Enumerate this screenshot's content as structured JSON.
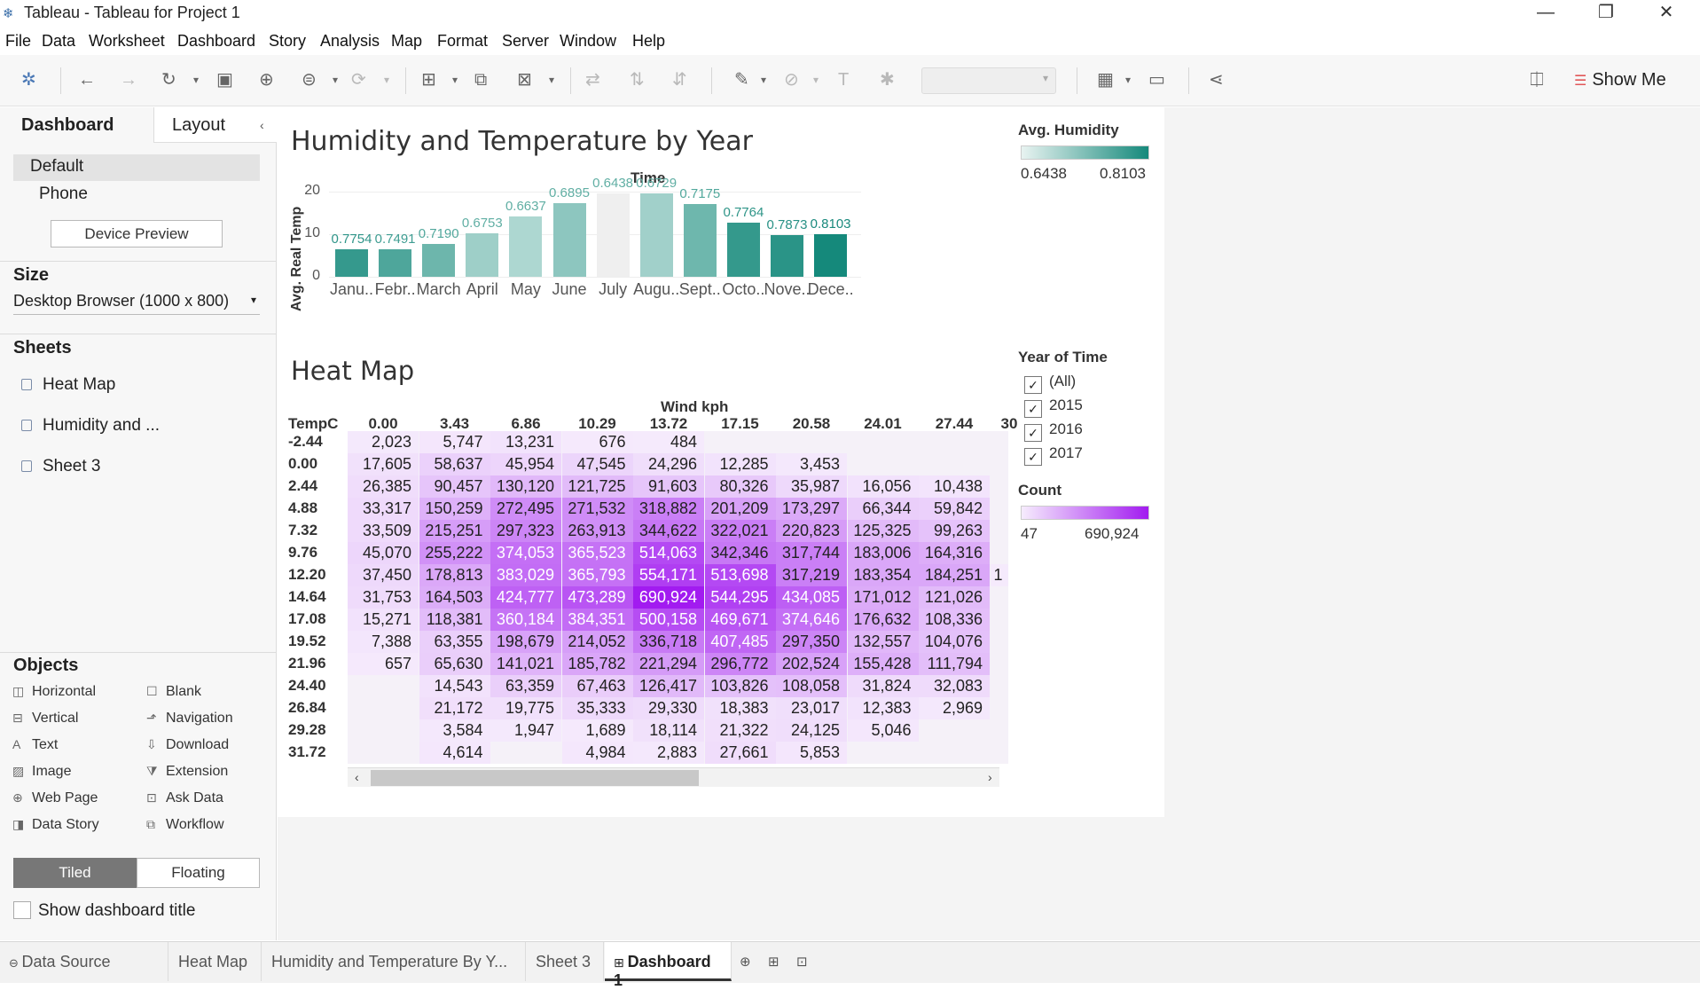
{
  "window": {
    "title": "Tableau - Tableau for Project 1",
    "minimize": "—",
    "restore": "❐",
    "close": "✕"
  },
  "menu": [
    "File",
    "Data",
    "Worksheet",
    "Dashboard",
    "Story",
    "Analysis",
    "Map",
    "Format",
    "Server",
    "Window",
    "Help"
  ],
  "toolbar": {
    "show_me": "Show Me"
  },
  "left_panel": {
    "tabs": {
      "dashboard": "Dashboard",
      "layout": "Layout"
    },
    "devices": [
      "Default",
      "Phone"
    ],
    "device_preview_button": "Device Preview",
    "size_heading": "Size",
    "size_value": "Desktop Browser (1000 x 800)",
    "sheets_heading": "Sheets",
    "sheets": [
      "Heat Map",
      "Humidity and ...",
      "Sheet 3"
    ],
    "objects_heading": "Objects",
    "objects": [
      {
        "label": "Horizontal",
        "icon": "horizontal-container-icon"
      },
      {
        "label": "Blank",
        "icon": "blank-icon"
      },
      {
        "label": "Vertical",
        "icon": "vertical-container-icon"
      },
      {
        "label": "Navigation",
        "icon": "navigation-icon"
      },
      {
        "label": "Text",
        "icon": "text-icon"
      },
      {
        "label": "Download",
        "icon": "download-icon"
      },
      {
        "label": "Image",
        "icon": "image-icon"
      },
      {
        "label": "Extension",
        "icon": "extension-icon"
      },
      {
        "label": "Web Page",
        "icon": "web-page-icon"
      },
      {
        "label": "Ask Data",
        "icon": "ask-data-icon"
      },
      {
        "label": "Data Story",
        "icon": "data-story-icon"
      },
      {
        "label": "Workflow",
        "icon": "workflow-icon"
      }
    ],
    "tiled_button": "Tiled",
    "floating_button": "Floating",
    "show_title_label": "Show dashboard title"
  },
  "dashboard": {
    "bar_title": "Humidity and Temperature by Year",
    "heat_title": "Heat Map",
    "humidity_legend": {
      "title": "Avg. Humidity",
      "min": "0.6438",
      "max": "0.8103",
      "color_low": "#e8f3f1",
      "color_high": "#15897b"
    },
    "year_filter": {
      "title": "Year of Time",
      "items": [
        "(All)",
        "2015",
        "2016",
        "2017"
      ]
    },
    "count_legend": {
      "title": "Count",
      "min": "47",
      "max": "690,924",
      "color_low": "#f6ecfd",
      "color_high": "#a21bf0"
    }
  },
  "chart_data": [
    {
      "type": "bar",
      "title": "Humidity and Temperature by Year",
      "column_header": "Time",
      "ylabel": "Avg. Real Temp",
      "yticks": [
        "20",
        "10",
        "0"
      ],
      "ylim": [
        0,
        20
      ],
      "categories": [
        "Janu..",
        "Febr..",
        "March",
        "April",
        "May",
        "June",
        "July",
        "Augu..",
        "Sept..",
        "Octo..",
        "Nove..",
        "Dece.."
      ],
      "values": [
        6.5,
        6.4,
        7.8,
        10.3,
        14.2,
        17.2,
        19.5,
        19.6,
        17.0,
        12.8,
        9.8,
        9.9
      ],
      "color_values": [
        0.7754,
        0.7491,
        0.719,
        0.6753,
        0.6637,
        0.6895,
        0.6438,
        0.6729,
        0.7175,
        0.7764,
        0.7873,
        0.8103
      ],
      "labels": [
        "0.7754",
        "0.7491",
        "0.7190",
        "0.6753",
        "0.6637",
        "0.6895",
        "0.6438",
        "0.6729",
        "0.7175",
        "0.7764",
        "0.7873",
        "0.8103"
      ]
    },
    {
      "type": "heatmap",
      "title": "Heat Map",
      "column_title": "Wind kph",
      "row_title": "TempC",
      "columns": [
        "0.00",
        "3.43",
        "6.86",
        "10.29",
        "13.72",
        "17.15",
        "20.58",
        "24.01",
        "27.44",
        "30"
      ],
      "rows": [
        "-2.44",
        "0.00",
        "2.44",
        "4.88",
        "7.32",
        "9.76",
        "12.20",
        "14.64",
        "17.08",
        "19.52",
        "21.96",
        "24.40",
        "26.84",
        "29.28",
        "31.72"
      ],
      "values": [
        [
          2023,
          5747,
          13231,
          676,
          484,
          null,
          null,
          null,
          null,
          null
        ],
        [
          17605,
          58637,
          45954,
          47545,
          24296,
          12285,
          3453,
          null,
          null,
          null
        ],
        [
          26385,
          90457,
          130120,
          121725,
          91603,
          80326,
          35987,
          16056,
          10438,
          null
        ],
        [
          33317,
          150259,
          272495,
          271532,
          318882,
          201209,
          173297,
          66344,
          59842,
          null
        ],
        [
          33509,
          215251,
          297323,
          263913,
          344622,
          322021,
          220823,
          125325,
          99263,
          null
        ],
        [
          45070,
          255222,
          374053,
          365523,
          514063,
          342346,
          317744,
          183006,
          164316,
          null
        ],
        [
          37450,
          178813,
          383029,
          365793,
          554171,
          513698,
          317219,
          183354,
          184251,
          1
        ],
        [
          31753,
          164503,
          424777,
          473289,
          690924,
          544295,
          434085,
          171012,
          121026,
          null
        ],
        [
          15271,
          118381,
          360184,
          384351,
          500158,
          469671,
          374646,
          176632,
          108336,
          null
        ],
        [
          7388,
          63355,
          198679,
          214052,
          336718,
          407485,
          297350,
          132557,
          104076,
          null
        ],
        [
          657,
          65630,
          141021,
          185782,
          221294,
          296772,
          202524,
          155428,
          111794,
          null
        ],
        [
          null,
          14543,
          63359,
          67463,
          126417,
          103826,
          108058,
          31824,
          32083,
          null
        ],
        [
          null,
          21172,
          19775,
          35333,
          29330,
          18383,
          23017,
          12383,
          2969,
          null
        ],
        [
          null,
          3584,
          1947,
          1689,
          18114,
          21322,
          24125,
          5046,
          null,
          null
        ],
        [
          null,
          4614,
          null,
          4984,
          2883,
          27661,
          5853,
          null,
          null,
          null
        ]
      ],
      "min": 47,
      "max": 690924
    }
  ],
  "bottom_tabs": [
    "Data Source",
    "Heat Map",
    "Humidity and Temperature By Y...",
    "Sheet 3",
    "Dashboard 1"
  ]
}
